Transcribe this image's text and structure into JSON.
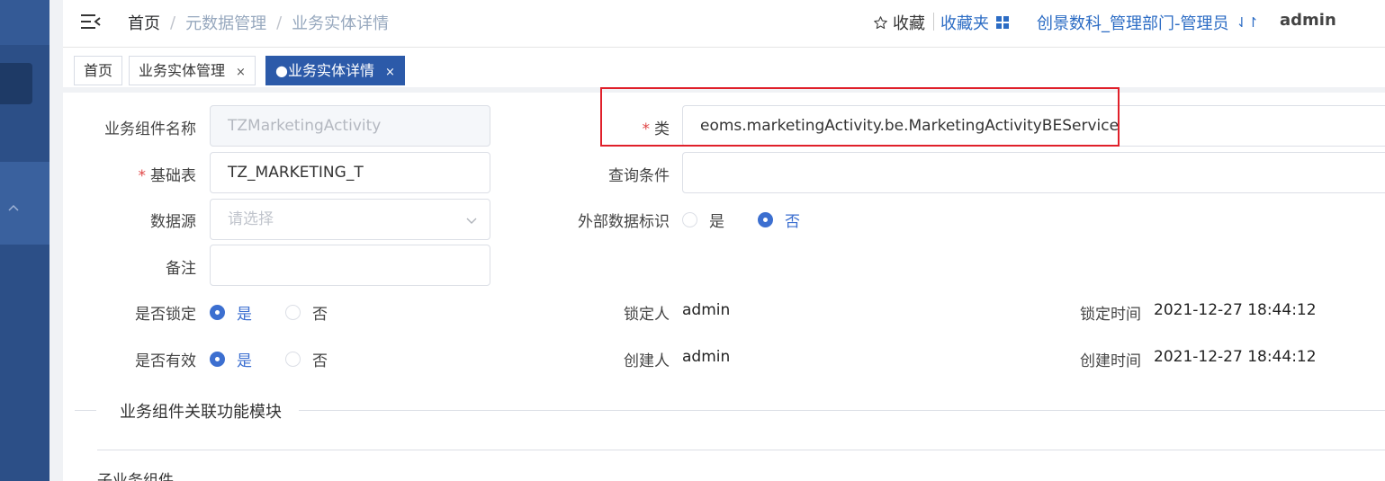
{
  "header": {
    "breadcrumb": [
      "首页",
      "元数据管理",
      "业务实体详情"
    ],
    "breadcrumb_sep": "/",
    "favorite_label": "收藏",
    "favorites_folder_label": "收藏夹",
    "org_label": "创景数科_管理部门-管理员",
    "swap_symbol": "⇃↾",
    "username": "admin"
  },
  "tabs": [
    {
      "label": "首页",
      "closable": false,
      "active": false
    },
    {
      "label": "业务实体管理",
      "closable": true,
      "active": false
    },
    {
      "label": "●业务实体详情",
      "closable": true,
      "active": true
    }
  ],
  "tab_close_symbol": "×",
  "form": {
    "component_name": {
      "label": "业务组件名称",
      "value": "TZMarketingActivity"
    },
    "class": {
      "label": "类",
      "value": "eoms.marketingActivity.be.MarketingActivityBEService",
      "required_mark": "*"
    },
    "base_table": {
      "label": "基础表",
      "value": "TZ_MARKETING_T",
      "required_mark": "*"
    },
    "query_condition": {
      "label": "查询条件",
      "value": ""
    },
    "datasource": {
      "label": "数据源",
      "placeholder": "请选择"
    },
    "external_flag": {
      "label": "外部数据标识",
      "options": [
        "是",
        "否"
      ],
      "selected": "否"
    },
    "remark": {
      "label": "备注",
      "value": ""
    },
    "locked": {
      "label": "是否锁定",
      "options": [
        "是",
        "否"
      ],
      "selected": "是"
    },
    "locker": {
      "label": "锁定人",
      "value": "admin"
    },
    "lock_time": {
      "label": "锁定时间",
      "value": "2021-12-27 18:44:12"
    },
    "valid": {
      "label": "是否有效",
      "options": [
        "是",
        "否"
      ],
      "selected": "是"
    },
    "creator": {
      "label": "创建人",
      "value": "admin"
    },
    "create_time": {
      "label": "创建时间",
      "value": "2021-12-27 18:44:12"
    }
  },
  "section": {
    "title": "业务组件关联功能模块"
  },
  "subsection": {
    "title": "子业务组件"
  },
  "colors": {
    "primary": "#2c5aa9",
    "radio_active": "#3c6fd0",
    "highlight_box": "#e0202a",
    "required": "#e04545",
    "sidebar": "#2c4f87"
  }
}
